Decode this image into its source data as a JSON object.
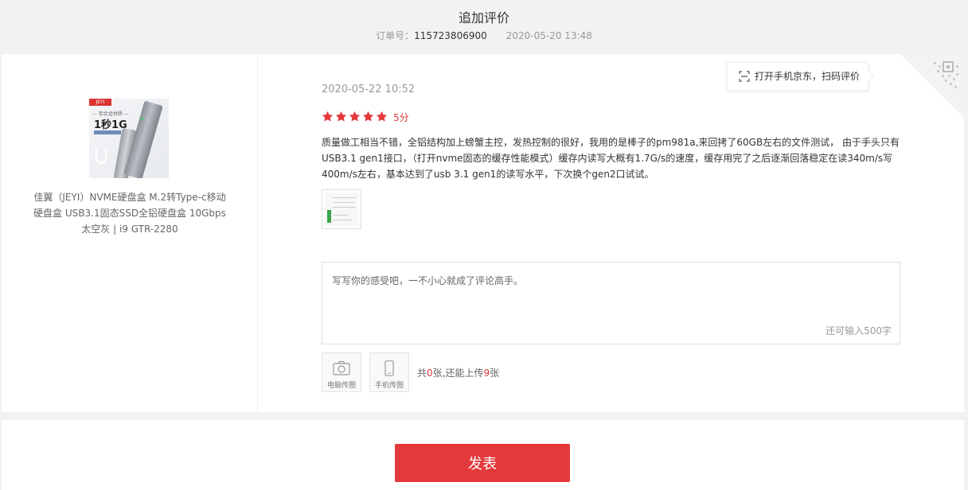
{
  "header": {
    "title": "追加评价",
    "order_label": "订单号：",
    "order_number": "115723806900",
    "order_time": "2020-05-20 13:48"
  },
  "product": {
    "image_brand": "JEYI",
    "image_promo": "— 铝合金材质 —",
    "image_headline": "1秒1G",
    "name": "佳翼（JEYI）NVME硬盘盒 M.2转Type-c移动硬盘盒 USB3.1固态SSD全铝硬盘盒 10Gbps 太空灰 | i9 GTR-2280"
  },
  "review": {
    "date": "2020-05-22 10:52",
    "rating": 5,
    "score_text": "5分",
    "text": "质量做工相当不错，全铝结构加上螃蟹主控，发热控制的很好，我用的是棒子的pm981a,来回拷了60GB左右的文件测试， 由于手头只有USB3.1 gen1接口，（打开nvme固态的缓存性能模式）缓存内读写大概有1.7G/s的速度，缓存用完了之后逐渐回落稳定在读340m/s写400m/s左右，基本达到了usb 3.1 gen1的读写水平，下次换个gen2口试试。"
  },
  "qr": {
    "tip": "打开手机京东，扫码评价"
  },
  "editor": {
    "placeholder": "写写你的感受吧，一不小心就成了评论高手。",
    "remaining": "还可输入500字"
  },
  "upload": {
    "pc_label": "电脑传图",
    "phone_label": "手机传图",
    "info_prefix": "共",
    "count_uploaded": "0",
    "info_middle": "张,还能上传",
    "count_remaining": "9",
    "info_suffix": "张"
  },
  "actions": {
    "submit": "发表"
  },
  "colors": {
    "accent": "#e4393c",
    "star": "#e4393c",
    "background": "#f2f2f2"
  }
}
